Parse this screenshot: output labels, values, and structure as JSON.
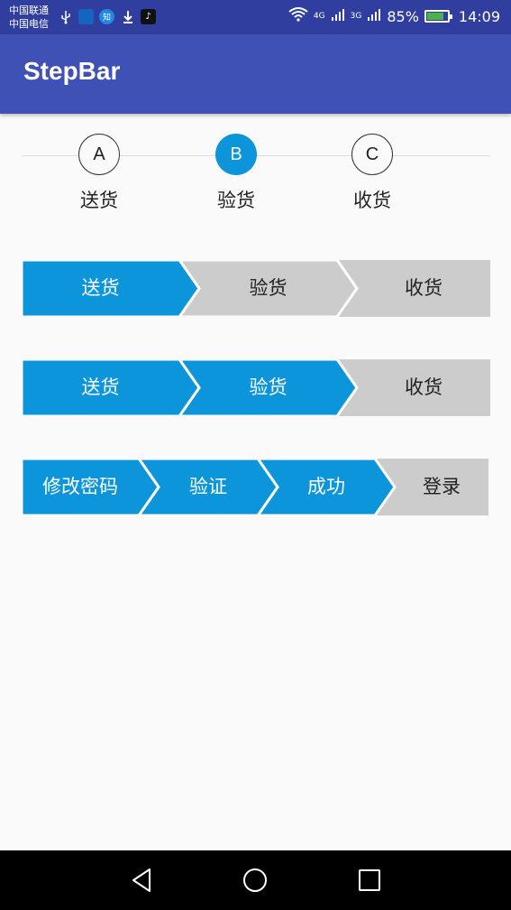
{
  "status_bar": {
    "carrier1": "中国联通",
    "carrier2": "中国电信",
    "network_label": "4G",
    "network2_label": "3G",
    "battery_percent": "85%",
    "battery_level": 85,
    "time": "14:09",
    "zhi_label": "知"
  },
  "app_bar": {
    "title": "StepBar"
  },
  "circle_stepbar": {
    "active_index": 1,
    "steps": [
      {
        "letter": "A",
        "label": "送货"
      },
      {
        "letter": "B",
        "label": "验货"
      },
      {
        "letter": "C",
        "label": "收货"
      }
    ]
  },
  "arrow_bars": [
    {
      "completed": 1,
      "steps": [
        "送货",
        "验货",
        "收货"
      ]
    },
    {
      "completed": 2,
      "steps": [
        "送货",
        "验货",
        "收货"
      ]
    },
    {
      "completed": 3,
      "steps": [
        "修改密码",
        "验证",
        "成功",
        "登录"
      ]
    }
  ],
  "colors": {
    "status_bar": "#303f9f",
    "app_bar": "#3f51b5",
    "active": "#0d95db",
    "inactive": "#cccccc",
    "background": "#fafafa"
  },
  "nav": {
    "back": "back-icon",
    "home": "home-icon",
    "recents": "recents-icon"
  }
}
